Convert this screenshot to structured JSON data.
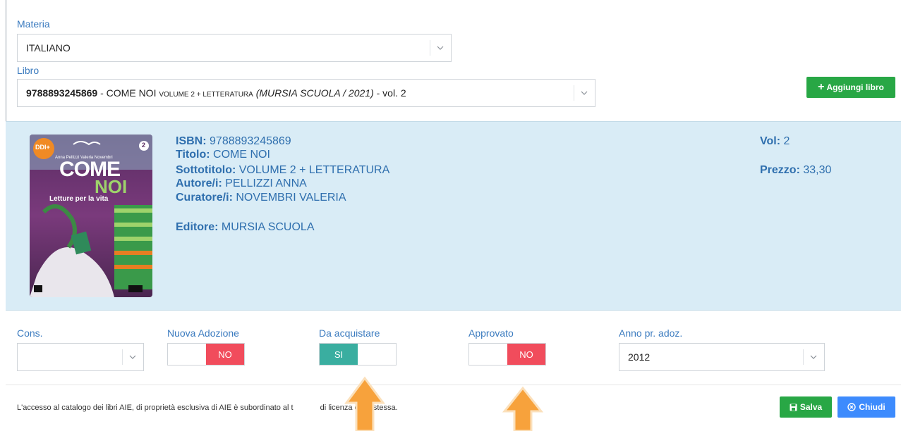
{
  "form": {
    "materia_label": "Materia",
    "materia_value": "ITALIANO",
    "libro_label": "Libro",
    "libro_isbn": "9788893245869",
    "libro_sep": " - COME NOI ",
    "libro_small": "VOLUME 2 + LETTERATURA",
    "libro_italic": "(MURSIA SCUOLA / 2021)",
    "libro_suffix": " - vol. 2",
    "add_button": "Aggiungi libro"
  },
  "book": {
    "isbn_label": "ISBN:",
    "isbn": "9788893245869",
    "titolo_label": "Titolo:",
    "titolo": "COME NOI",
    "sottotitolo_label": "Sottotitolo:",
    "sottotitolo": "VOLUME 2 + LETTERATURA",
    "autore_label": "Autore/i:",
    "autore": "PELLIZZI ANNA",
    "curatore_label": "Curatore/i:",
    "curatore": "NOVEMBRI VALERIA",
    "editore_label": "Editore:",
    "editore": "MURSIA SCUOLA",
    "vol_label": "Vol:",
    "vol": "2",
    "prezzo_label": "Prezzo:",
    "prezzo": "33,30",
    "cover": {
      "title_1": "COME",
      "title_2": "NOI",
      "subtitle": "Letture per la vita",
      "authors": "Anna Pellizzi  Valeria Novembri",
      "badge": "DDI+",
      "volume": "2"
    }
  },
  "options": {
    "cons_label": "Cons.",
    "cons_value": "",
    "nuova_label": "Nuova Adozione",
    "nuova_value": "NO",
    "acquistare_label": "Da acquistare",
    "acquistare_value": "SI",
    "approvato_label": "Approvato",
    "approvato_value": "NO",
    "anno_label": "Anno pr. adoz.",
    "anno_value": "2012"
  },
  "footer": {
    "notice_a": "L'accesso al catalogo dei libri AIE, di proprietà esclusiva di AIE è subordinato al t",
    "notice_b": "di licenza della stessa.",
    "save_button": "Salva",
    "close_button": "Chiudi"
  },
  "colors": {
    "label_blue": "#3b7bbf",
    "panel_bg": "#d9ecf6",
    "toggle_no": "#f14c5c",
    "toggle_si": "#3aaea0",
    "button_green": "#28a745",
    "button_blue": "#3d8bfd",
    "arrow_orange": "#f7a23c"
  }
}
